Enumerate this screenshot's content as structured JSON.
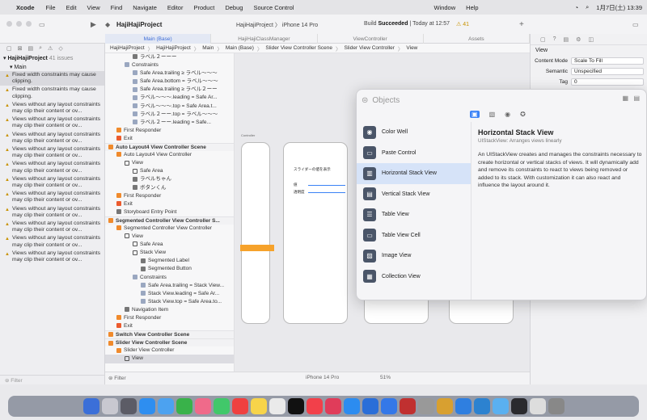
{
  "menubar": {
    "app": "Xcode",
    "menus": [
      "File",
      "Edit",
      "View",
      "Find",
      "Navigate",
      "Editor",
      "Product",
      "Debug",
      "Source Control",
      "Window",
      "Help"
    ],
    "clock": "1月7日(土)  13:39"
  },
  "toolbar": {
    "project": "HajiHajiProject",
    "scheme": "HajiHajiProject",
    "device": "iPhone 14 Pro",
    "status_prefix": "Build ",
    "status_bold": "Succeeded",
    "status_time": " | Today at 12:57",
    "warnings": "⚠ 41"
  },
  "tabs": [
    "Main (Base)",
    "HajiHajiClassManager",
    "ViewController",
    "Assets"
  ],
  "navigator": {
    "project": "HajiHajiProject",
    "count": "41 issues",
    "group": "Main",
    "issues": [
      {
        "text": "Fixed width constraints may cause clipping.",
        "sel": true
      },
      {
        "text": "Fixed width constraints may cause clipping."
      },
      {
        "text": "Views without any layout constraints may clip their content or ov..."
      },
      {
        "text": "Views without any layout constraints may clip their content or ov..."
      },
      {
        "text": "Views without any layout constraints may clip their content or ov..."
      },
      {
        "text": "Views without any layout constraints may clip their content or ov..."
      },
      {
        "text": "Views without any layout constraints may clip their content or ov..."
      },
      {
        "text": "Views without any layout constraints may clip their content or ov..."
      },
      {
        "text": "Views without any layout constraints may clip their content or ov..."
      },
      {
        "text": "Views without any layout constraints may clip their content or ov..."
      },
      {
        "text": "Views without any layout constraints may clip their content or ov..."
      },
      {
        "text": "Views without any layout constraints may clip their content or ov..."
      },
      {
        "text": "Views without any layout constraints may clip their content or ov..."
      }
    ],
    "filter": "Filter"
  },
  "jumpbar": [
    "HajiHajiProject",
    "HajiHajiProject",
    "Main",
    "Main (Base)",
    "Slider View Controller Scene",
    "Slider View Controller",
    "View"
  ],
  "outline": [
    {
      "t": "ラベル２ーーー",
      "d": 3,
      "i": "ic-g"
    },
    {
      "t": "Constraints",
      "d": 2,
      "i": "ic-c"
    },
    {
      "t": "Safe Area.trailing ≥ ラベル〜〜〜",
      "d": 3,
      "i": "ic-c"
    },
    {
      "t": "Safe Area.bottom = ラベル〜〜〜",
      "d": 3,
      "i": "ic-c"
    },
    {
      "t": "Safe Area.trailing ≥ ラベル２ーー",
      "d": 3,
      "i": "ic-c"
    },
    {
      "t": "ラベル〜〜〜.leading = Safe Ar...",
      "d": 3,
      "i": "ic-c"
    },
    {
      "t": "ラベル〜〜〜.top = Safe Area.t...",
      "d": 3,
      "i": "ic-c"
    },
    {
      "t": "ラベル２ーー.top = ラベル〜〜〜",
      "d": 3,
      "i": "ic-c"
    },
    {
      "t": "ラベル２ーー.leading = Safe...",
      "d": 3,
      "i": "ic-c"
    },
    {
      "t": "First Responder",
      "d": 1,
      "i": "ic-o"
    },
    {
      "t": "Exit",
      "d": 1,
      "i": "ic-r"
    },
    {
      "t": "Auto Layout4 View Controller Scene",
      "d": 0,
      "h": true,
      "i": "ic-o"
    },
    {
      "t": "Auto Layout4 View Controller",
      "d": 1,
      "i": "ic-o"
    },
    {
      "t": "View",
      "d": 2,
      "i": "ic-v"
    },
    {
      "t": "Safe Area",
      "d": 3,
      "i": "ic-v"
    },
    {
      "t": "ラベルちゃん",
      "d": 3,
      "i": "ic-g"
    },
    {
      "t": "ボタンくん",
      "d": 3,
      "i": "ic-g"
    },
    {
      "t": "First Responder",
      "d": 1,
      "i": "ic-o"
    },
    {
      "t": "Exit",
      "d": 1,
      "i": "ic-r"
    },
    {
      "t": "Storyboard Entry Point",
      "d": 1,
      "i": "ic-g"
    },
    {
      "t": "Segmented Controller View Controller S...",
      "d": 0,
      "h": true,
      "i": "ic-o"
    },
    {
      "t": "Segmented Controller View Controller",
      "d": 1,
      "i": "ic-o"
    },
    {
      "t": "View",
      "d": 2,
      "i": "ic-v"
    },
    {
      "t": "Safe Area",
      "d": 3,
      "i": "ic-v"
    },
    {
      "t": "Stack View",
      "d": 3,
      "i": "ic-v"
    },
    {
      "t": "Segmented Label",
      "d": 4,
      "i": "ic-g"
    },
    {
      "t": "Segmented Button",
      "d": 4,
      "i": "ic-g"
    },
    {
      "t": "Constraints",
      "d": 3,
      "i": "ic-c"
    },
    {
      "t": "Safe Area.trailing = Stack View...",
      "d": 4,
      "i": "ic-c"
    },
    {
      "t": "Stack View.leading = Safe Ar...",
      "d": 4,
      "i": "ic-c"
    },
    {
      "t": "Stack View.top = Safe Area.to...",
      "d": 4,
      "i": "ic-c"
    },
    {
      "t": "Navigation Item",
      "d": 2,
      "i": "ic-g"
    },
    {
      "t": "First Responder",
      "d": 1,
      "i": "ic-o"
    },
    {
      "t": "Exit",
      "d": 1,
      "i": "ic-r"
    },
    {
      "t": "Switch View Controller Scene",
      "d": 0,
      "h": true,
      "i": "ic-o"
    },
    {
      "t": "Slider View Controller Scene",
      "d": 0,
      "h": true,
      "i": "ic-o"
    },
    {
      "t": "Slider View Controller",
      "d": 1,
      "i": "ic-o"
    },
    {
      "t": "View",
      "d": 2,
      "i": "ic-v",
      "sel": true
    }
  ],
  "canvas": {
    "phone_label": "Controller",
    "slider_title": "スライダーの値を表示",
    "row1": "値",
    "row2": "透明度"
  },
  "bottombar": {
    "device": "iPhone 14 Pro",
    "zoom": "51%",
    "filter": "Filter"
  },
  "inspector": {
    "title": "View",
    "rows": [
      {
        "label": "Content Mode",
        "value": "Scale To Fill"
      },
      {
        "label": "Semantic",
        "value": "Unspecified"
      },
      {
        "label": "Tag",
        "value": "0"
      }
    ]
  },
  "library": {
    "search": "Objects",
    "items": [
      "Color Well",
      "Paste Control",
      "Horizontal Stack View",
      "Vertical Stack View",
      "Table View",
      "Table View Cell",
      "Image View",
      "Collection View"
    ],
    "selected": 2,
    "detail_title": "Horizontal Stack View",
    "detail_sub": "UIStackView: Arranges views linearly",
    "detail_desc": "An UIStackView creates and manages the constraints necessary to create horizontal or vertical stacks of views. It will dynamically add and remove its constraints to react to views being removed or added to its stack. With customization it can also react and influence the layout around it."
  }
}
